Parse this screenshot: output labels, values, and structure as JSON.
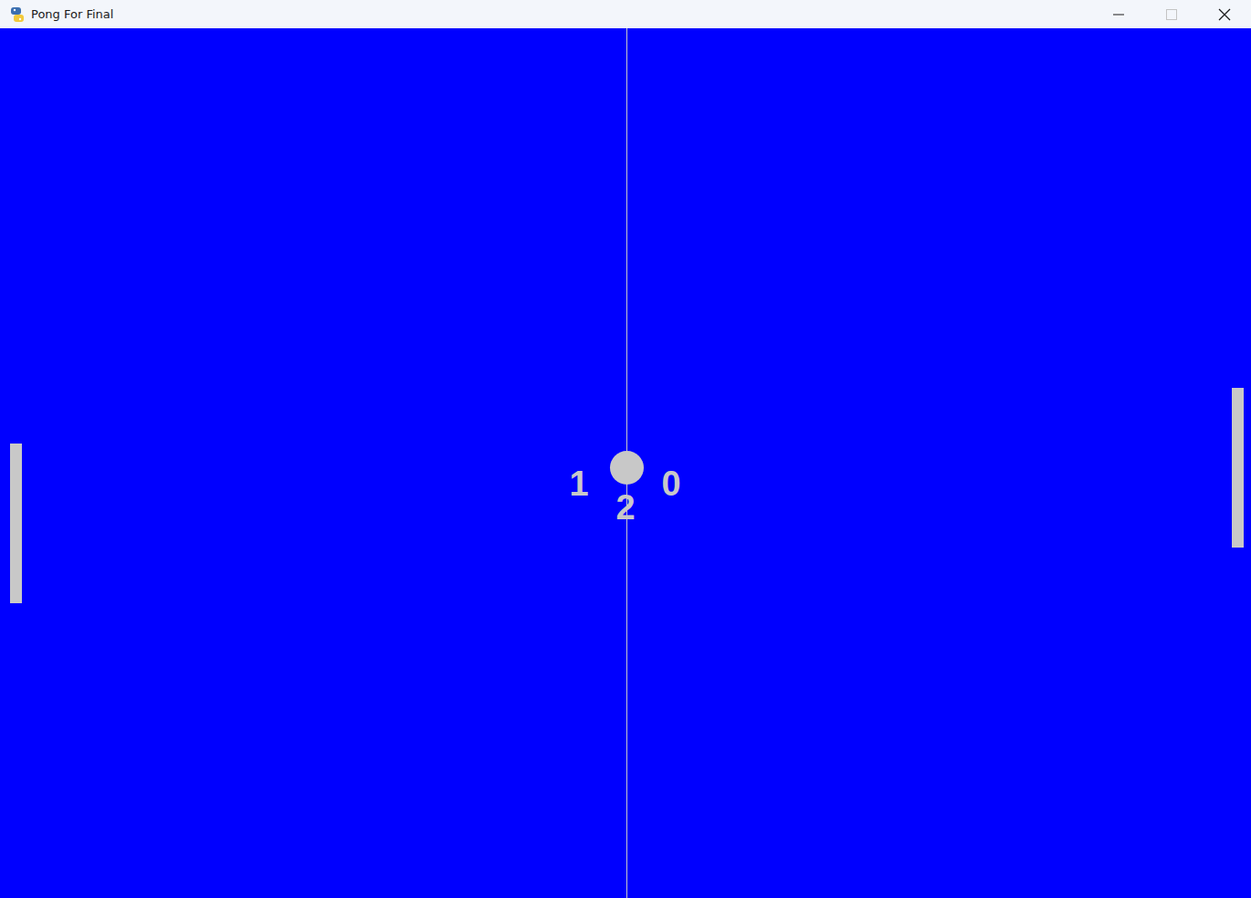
{
  "window": {
    "title": "Pong For Final",
    "controls": [
      {
        "kind": "minimize",
        "disabled": false
      },
      {
        "kind": "maximize",
        "disabled": true
      },
      {
        "kind": "close",
        "disabled": false
      }
    ]
  },
  "score": {
    "left": "1",
    "right": "0"
  },
  "countdown": "2"
}
